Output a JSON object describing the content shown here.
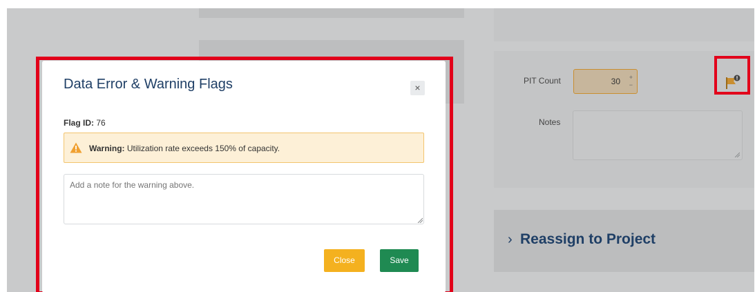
{
  "background": {
    "pit_count": {
      "label": "PIT Count",
      "value": "30",
      "increment": "+",
      "decrement": "−"
    },
    "notes": {
      "label": "Notes"
    },
    "reassign": {
      "chevron": "›",
      "title": "Reassign to Project"
    },
    "flag_icon": "flag-icon"
  },
  "modal": {
    "title": "Data Error & Warning Flags",
    "close_icon": "×",
    "flag_id_label": "Flag ID:",
    "flag_id_value": "76",
    "warning_label": "Warning:",
    "warning_text": "Utilization rate exceeds 150% of capacity.",
    "note_placeholder": "Add a note for the warning above.",
    "close_button": "Close",
    "save_button": "Save"
  },
  "colors": {
    "highlight": "#e2001a",
    "title": "#1f3f66",
    "warning_bg": "#fdf0d7",
    "close_button": "#f4b11f",
    "save_button": "#1f8a52"
  }
}
